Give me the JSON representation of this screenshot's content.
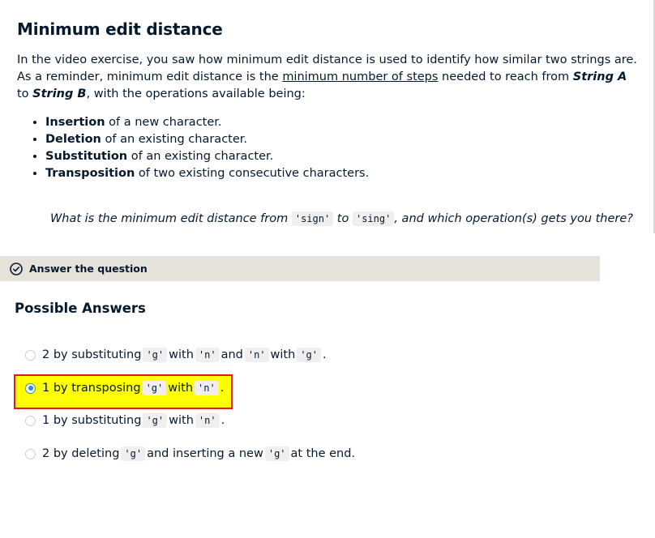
{
  "exercise": {
    "title": "Minimum edit distance",
    "intro_part1": "In the video exercise, you saw how minimum edit distance is used to identify how similar two strings are. As a reminder, minimum edit distance is the ",
    "intro_link": "minimum number of steps",
    "intro_part2": " needed to reach from ",
    "string_a": "String A",
    "intro_to": " to ",
    "string_b": "String B",
    "intro_part3": ", with the operations available being:",
    "operations": [
      {
        "name": "Insertion",
        "desc": " of a new character."
      },
      {
        "name": "Deletion",
        "desc": " of an existing character."
      },
      {
        "name": "Substitution",
        "desc": " of an existing character."
      },
      {
        "name": "Transposition",
        "desc": " of two existing consecutive characters."
      }
    ],
    "question": {
      "part1": "What is the minimum edit distance from ",
      "code1": "'sign'",
      "part2": " to ",
      "code2": "'sing'",
      "part3": ", and which operation(s) gets you there?"
    }
  },
  "answer_bar": {
    "icon": "check-circle-icon",
    "label": "Answer the question"
  },
  "possible_answers": {
    "heading": "Possible Answers",
    "options": [
      {
        "selected": false,
        "t1": "2 by substituting ",
        "c1": "'g'",
        "t2": " with ",
        "c2": "'n'",
        "t3": " and ",
        "c3": "'n'",
        "t4": " with ",
        "c4": "'g'",
        "t5": "."
      },
      {
        "selected": true,
        "t1": "1 by transposing ",
        "c1": "'g'",
        "t2": " with ",
        "c2": "'n'",
        "t3": "."
      },
      {
        "selected": false,
        "t1": "1 by substituting ",
        "c1": "'g'",
        "t2": " with ",
        "c2": "'n'",
        "t3": "."
      },
      {
        "selected": false,
        "t1": "2 by deleting ",
        "c1": "'g'",
        "t2": " and inserting a new ",
        "c2": "'g'",
        "t3": " at the end."
      }
    ]
  },
  "colors": {
    "highlight": "#ffff00",
    "highlight_border": "#e0191f",
    "radio_selected": "#2f8bd6",
    "answer_bar_bg": "#e6e3dd"
  }
}
